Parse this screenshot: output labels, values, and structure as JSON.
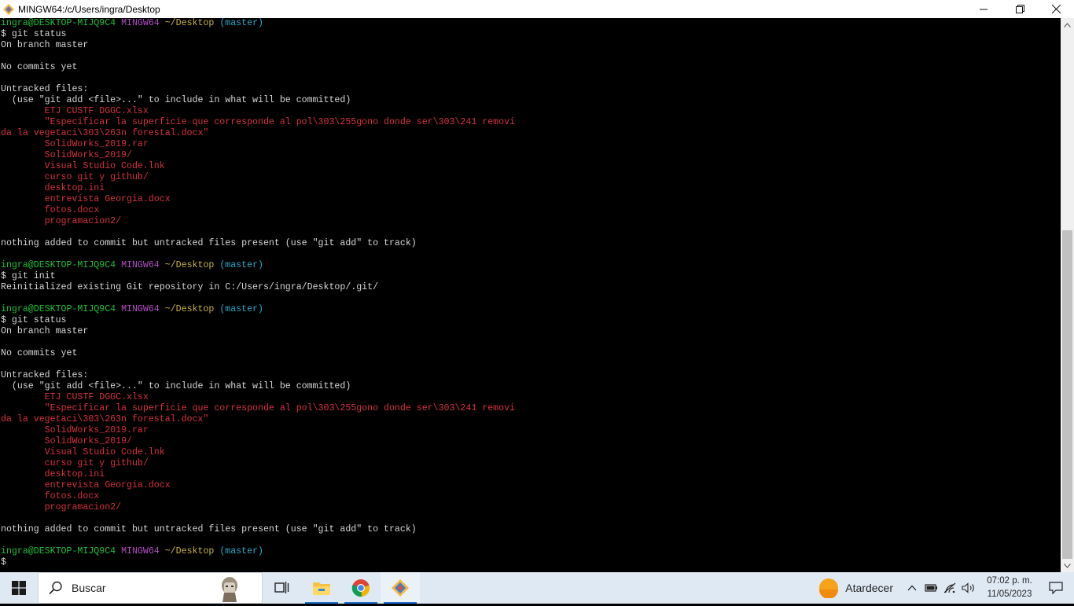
{
  "window": {
    "title": "MINGW64:/c/Users/ingra/Desktop"
  },
  "colors": {
    "user_host": "#1fbf3a",
    "shell": "#b14ec5",
    "path": "#c9b23b",
    "branch": "#2aa8c8",
    "untracked": "#d3313f",
    "text": "#d6d6d6"
  },
  "terminal": {
    "lines": [
      {
        "segments": [
          {
            "t": "ingra@DESKTOP-MIJQ9C4 ",
            "c": "c-green"
          },
          {
            "t": "MINGW64 ",
            "c": "c-purple"
          },
          {
            "t": "~/Desktop ",
            "c": "c-yellow"
          },
          {
            "t": "(master)",
            "c": "c-cyan"
          }
        ]
      },
      {
        "segments": [
          {
            "t": "$ git status",
            "c": "c-white"
          }
        ]
      },
      {
        "segments": [
          {
            "t": "On branch master",
            "c": "c-white"
          }
        ]
      },
      {
        "segments": []
      },
      {
        "segments": [
          {
            "t": "No commits yet",
            "c": "c-white"
          }
        ]
      },
      {
        "segments": []
      },
      {
        "segments": [
          {
            "t": "Untracked files:",
            "c": "c-white"
          }
        ]
      },
      {
        "segments": [
          {
            "t": "  (use \"git add <file>...\" to include in what will be committed)",
            "c": "c-white"
          }
        ]
      },
      {
        "segments": [
          {
            "t": "        ETJ CUSTF DGGC.xlsx",
            "c": "c-red"
          }
        ]
      },
      {
        "segments": [
          {
            "t": "        \"Especificar la superficie que corresponde al pol\\303\\255gono donde ser\\303\\241 removi",
            "c": "c-red"
          }
        ]
      },
      {
        "segments": [
          {
            "t": "da la vegetaci\\303\\263n forestal.docx\"",
            "c": "c-red"
          }
        ]
      },
      {
        "segments": [
          {
            "t": "        SolidWorks_2019.rar",
            "c": "c-red"
          }
        ]
      },
      {
        "segments": [
          {
            "t": "        SolidWorks_2019/",
            "c": "c-red"
          }
        ]
      },
      {
        "segments": [
          {
            "t": "        Visual Studio Code.lnk",
            "c": "c-red"
          }
        ]
      },
      {
        "segments": [
          {
            "t": "        curso git y github/",
            "c": "c-red"
          }
        ]
      },
      {
        "segments": [
          {
            "t": "        desktop.ini",
            "c": "c-red"
          }
        ]
      },
      {
        "segments": [
          {
            "t": "        entrevista Georgia.docx",
            "c": "c-red"
          }
        ]
      },
      {
        "segments": [
          {
            "t": "        fotos.docx",
            "c": "c-red"
          }
        ]
      },
      {
        "segments": [
          {
            "t": "        programacion2/",
            "c": "c-red"
          }
        ]
      },
      {
        "segments": []
      },
      {
        "segments": [
          {
            "t": "nothing added to commit but untracked files present (use \"git add\" to track)",
            "c": "c-white"
          }
        ]
      },
      {
        "segments": []
      },
      {
        "segments": [
          {
            "t": "ingra@DESKTOP-MIJQ9C4 ",
            "c": "c-green"
          },
          {
            "t": "MINGW64 ",
            "c": "c-purple"
          },
          {
            "t": "~/Desktop ",
            "c": "c-yellow"
          },
          {
            "t": "(master)",
            "c": "c-cyan"
          }
        ]
      },
      {
        "segments": [
          {
            "t": "$ git init",
            "c": "c-white"
          }
        ]
      },
      {
        "segments": [
          {
            "t": "Reinitialized existing Git repository in C:/Users/ingra/Desktop/.git/",
            "c": "c-white"
          }
        ]
      },
      {
        "segments": []
      },
      {
        "segments": [
          {
            "t": "ingra@DESKTOP-MIJQ9C4 ",
            "c": "c-green"
          },
          {
            "t": "MINGW64 ",
            "c": "c-purple"
          },
          {
            "t": "~/Desktop ",
            "c": "c-yellow"
          },
          {
            "t": "(master)",
            "c": "c-cyan"
          }
        ]
      },
      {
        "segments": [
          {
            "t": "$ git status",
            "c": "c-white"
          }
        ]
      },
      {
        "segments": [
          {
            "t": "On branch master",
            "c": "c-white"
          }
        ]
      },
      {
        "segments": []
      },
      {
        "segments": [
          {
            "t": "No commits yet",
            "c": "c-white"
          }
        ]
      },
      {
        "segments": []
      },
      {
        "segments": [
          {
            "t": "Untracked files:",
            "c": "c-white"
          }
        ]
      },
      {
        "segments": [
          {
            "t": "  (use \"git add <file>...\" to include in what will be committed)",
            "c": "c-white"
          }
        ]
      },
      {
        "segments": [
          {
            "t": "        ETJ CUSTF DGGC.xlsx",
            "c": "c-red"
          }
        ]
      },
      {
        "segments": [
          {
            "t": "        \"Especificar la superficie que corresponde al pol\\303\\255gono donde ser\\303\\241 removi",
            "c": "c-red"
          }
        ]
      },
      {
        "segments": [
          {
            "t": "da la vegetaci\\303\\263n forestal.docx\"",
            "c": "c-red"
          }
        ]
      },
      {
        "segments": [
          {
            "t": "        SolidWorks_2019.rar",
            "c": "c-red"
          }
        ]
      },
      {
        "segments": [
          {
            "t": "        SolidWorks_2019/",
            "c": "c-red"
          }
        ]
      },
      {
        "segments": [
          {
            "t": "        Visual Studio Code.lnk",
            "c": "c-red"
          }
        ]
      },
      {
        "segments": [
          {
            "t": "        curso git y github/",
            "c": "c-red"
          }
        ]
      },
      {
        "segments": [
          {
            "t": "        desktop.ini",
            "c": "c-red"
          }
        ]
      },
      {
        "segments": [
          {
            "t": "        entrevista Georgia.docx",
            "c": "c-red"
          }
        ]
      },
      {
        "segments": [
          {
            "t": "        fotos.docx",
            "c": "c-red"
          }
        ]
      },
      {
        "segments": [
          {
            "t": "        programacion2/",
            "c": "c-red"
          }
        ]
      },
      {
        "segments": []
      },
      {
        "segments": [
          {
            "t": "nothing added to commit but untracked files present (use \"git add\" to track)",
            "c": "c-white"
          }
        ]
      },
      {
        "segments": []
      },
      {
        "segments": [
          {
            "t": "ingra@DESKTOP-MIJQ9C4 ",
            "c": "c-green"
          },
          {
            "t": "MINGW64 ",
            "c": "c-purple"
          },
          {
            "t": "~/Desktop ",
            "c": "c-yellow"
          },
          {
            "t": "(master)",
            "c": "c-cyan"
          }
        ]
      },
      {
        "segments": [
          {
            "t": "$",
            "c": "c-white"
          }
        ]
      }
    ]
  },
  "taskbar": {
    "search_label": "Buscar",
    "weather_label": "Atardecer",
    "time": "07:02 p. m.",
    "date": "11/05/2023",
    "apps": [
      {
        "name": "task-view-icon"
      },
      {
        "name": "file-explorer-icon"
      },
      {
        "name": "chrome-icon"
      },
      {
        "name": "git-bash-icon"
      }
    ]
  }
}
